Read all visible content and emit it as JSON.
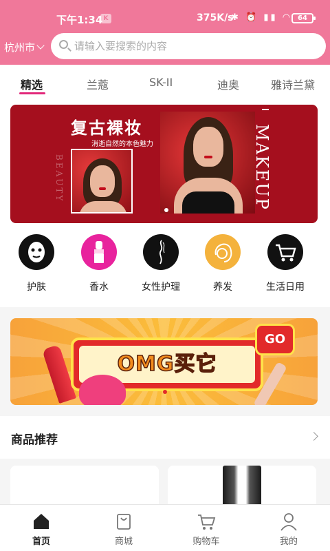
{
  "status_bar": {
    "time": "下午1:34",
    "badge": "K",
    "network_speed": "375K/s",
    "icons": "✱ ⏰ ▮▮ ◠",
    "battery": "64"
  },
  "header": {
    "city": "杭州市",
    "search_placeholder": "请输入要搜索的内容"
  },
  "tabs": [
    {
      "label": "精选",
      "active": true
    },
    {
      "label": "兰蔻",
      "active": false
    },
    {
      "label": "SK-II",
      "active": false
    },
    {
      "label": "迪奥",
      "active": false
    },
    {
      "label": "雅诗兰黛",
      "active": false
    }
  ],
  "banner1": {
    "title": "复古裸妆",
    "subtitle": "消逝自然的本色魅力",
    "side_text": "BEAUTY",
    "vertical_text": "MAKEUP"
  },
  "categories": [
    {
      "label": "护肤",
      "icon": "face-mask-icon",
      "color": "#111111"
    },
    {
      "label": "香水",
      "icon": "lipstick-icon",
      "color": "#e8239d"
    },
    {
      "label": "女性护理",
      "icon": "woman-silhouette-icon",
      "color": "#111111"
    },
    {
      "label": "养发",
      "icon": "hair-icon",
      "color": "#f4b23c"
    },
    {
      "label": "生活日用",
      "icon": "shopping-cart-icon",
      "color": "#111111"
    }
  ],
  "banner2": {
    "text": "OMG买它",
    "go_label": "GO"
  },
  "recommend": {
    "title": "商品推荐"
  },
  "nav": [
    {
      "label": "首页",
      "icon": "home-icon",
      "active": true
    },
    {
      "label": "商城",
      "icon": "shopping-bag-icon",
      "active": false
    },
    {
      "label": "购物车",
      "icon": "cart-icon",
      "active": false
    },
    {
      "label": "我的",
      "icon": "user-icon",
      "active": false
    }
  ],
  "colors": {
    "header_bg": "#f0789a",
    "accent": "#e2277a"
  }
}
